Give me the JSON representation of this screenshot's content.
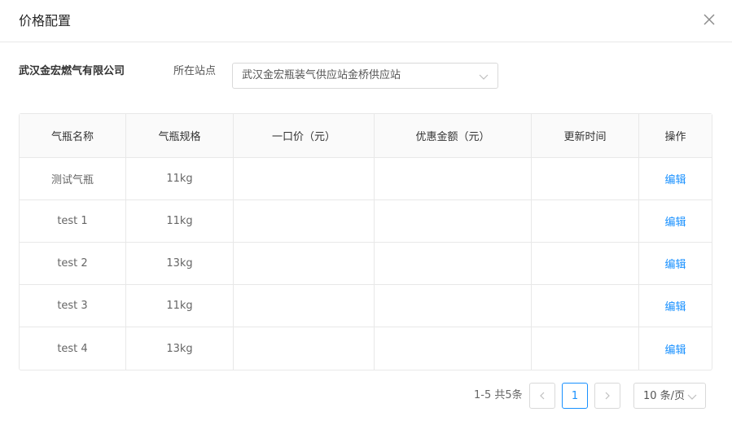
{
  "dialog": {
    "title": "价格配置",
    "close_icon": "close-icon"
  },
  "filter": {
    "company": "武汉金宏燃气有限公司",
    "station_label": "所在站点",
    "station_value": "武汉金宏瓶装气供应站金桥供应站"
  },
  "table": {
    "columns": [
      "气瓶名称",
      "气瓶规格",
      "一口价（元）",
      "优惠金额（元）",
      "更新时间",
      "操作"
    ],
    "rows": [
      {
        "name": "测试气瓶",
        "spec": "11kg",
        "price": "",
        "discount": "",
        "updated": "",
        "action": "编辑"
      },
      {
        "name": "test 1",
        "spec": "11kg",
        "price": "",
        "discount": "",
        "updated": "",
        "action": "编辑"
      },
      {
        "name": "test 2",
        "spec": "13kg",
        "price": "",
        "discount": "",
        "updated": "",
        "action": "编辑"
      },
      {
        "name": "test 3",
        "spec": "11kg",
        "price": "",
        "discount": "",
        "updated": "",
        "action": "编辑"
      },
      {
        "name": "test 4",
        "spec": "13kg",
        "price": "",
        "discount": "",
        "updated": "",
        "action": "编辑"
      }
    ]
  },
  "pagination": {
    "total_text": "1-5 共5条",
    "current_page": "1",
    "page_size": "10 条/页",
    "prev_icon": "chevron-left-icon",
    "next_icon": "chevron-right-icon"
  },
  "colors": {
    "link": "#1890ff",
    "border": "#e8e8e8",
    "header_bg": "#fafafa"
  }
}
